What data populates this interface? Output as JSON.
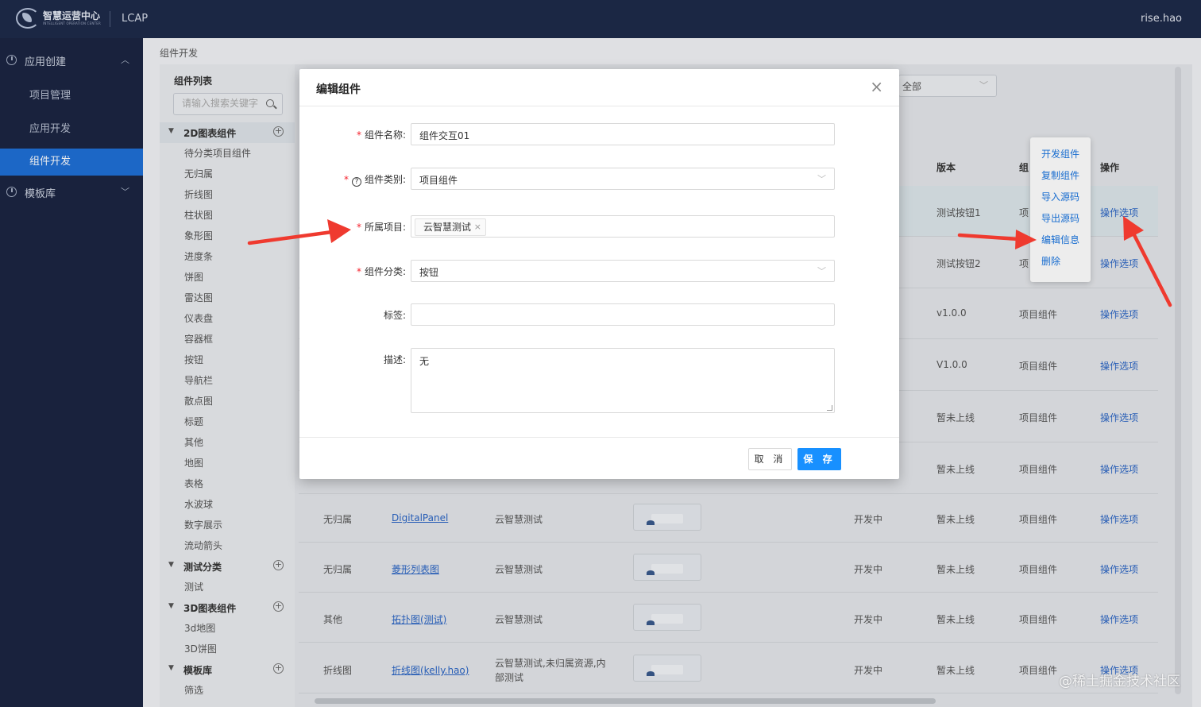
{
  "header": {
    "logo_title": "智慧运营中心",
    "logo_sub": "INTELLIGENT OPERATION CENTER",
    "app_name": "LCAP",
    "user": "rise.hao"
  },
  "sidebar": {
    "group_app": "应用创建",
    "items": [
      "项目管理",
      "应用开发",
      "组件开发"
    ],
    "group_templates": "模板库"
  },
  "breadcrumb": "组件开发",
  "tree": {
    "title": "组件列表",
    "search_placeholder": "请输入搜索关键字",
    "cat_2d": "2D图表组件",
    "leaves_2d": [
      "待分类项目组件",
      "无归属",
      "折线图",
      "柱状图",
      "象形图",
      "进度条",
      "饼图",
      "雷达图",
      "仪表盘",
      "容器框",
      "按钮",
      "导航栏",
      "散点图",
      "标题",
      "其他",
      "地图",
      "表格",
      "水波球",
      "数字展示",
      "流动箭头"
    ],
    "cat_test": "测试分类",
    "leaves_test": [
      "测试"
    ],
    "cat_3d": "3D图表组件",
    "leaves_3d": [
      "3d地图",
      "3D饼图"
    ],
    "cat_tpl": "模板库",
    "leaves_tpl": [
      "筛选"
    ]
  },
  "filter": {
    "value": "全部"
  },
  "table": {
    "headers": {
      "version": "版本",
      "group": "组",
      "action": "操作"
    },
    "rows_partial": [
      {
        "version": "测试按钮1",
        "group": "项",
        "action": "操作选项"
      },
      {
        "version": "测试按钮2",
        "group": "项",
        "action": "操作选项"
      },
      {
        "version": "v1.0.0",
        "group": "项目组件",
        "action": "操作选项"
      },
      {
        "version": "V1.0.0",
        "group": "项目组件",
        "action": "操作选项"
      },
      {
        "version": "暂未上线",
        "group": "项目组件",
        "action": "操作选项"
      },
      {
        "version": "暂未上线",
        "group": "项目组件",
        "action": "操作选项"
      }
    ],
    "rows_full": [
      {
        "cat": "无归属",
        "name": "DigitalPanel",
        "project": "云智慧测试",
        "status": "开发中",
        "version": "暂未上线",
        "group": "项目组件",
        "action": "操作选项"
      },
      {
        "cat": "无归属",
        "name": "菱形列表图",
        "project": "云智慧测试",
        "status": "开发中",
        "version": "暂未上线",
        "group": "项目组件",
        "action": "操作选项"
      },
      {
        "cat": "其他",
        "name": "拓扑图(测试)",
        "project": "云智慧测试",
        "status": "开发中",
        "version": "暂未上线",
        "group": "项目组件",
        "action": "操作选项"
      },
      {
        "cat": "折线图",
        "name": "折线图(kelly.hao)",
        "project": "云智慧测试,未归属资源,内部测试",
        "status": "开发中",
        "version": "暂未上线",
        "group": "项目组件",
        "action": "操作选项"
      }
    ]
  },
  "popmenu": [
    "开发组件",
    "复制组件",
    "导入源码",
    "导出源码",
    "编辑信息",
    "删除"
  ],
  "modal": {
    "title": "编辑组件",
    "fields": {
      "name_label": "组件名称:",
      "name_value": "组件交互01",
      "type_label": "组件类别:",
      "type_value": "项目组件",
      "project_label": "所属项目:",
      "project_tag": "云智慧测试",
      "class_label": "组件分类:",
      "class_value": "按钮",
      "tags_label": "标签:",
      "tags_value": "",
      "desc_label": "描述:",
      "desc_value": "无"
    },
    "cancel": "取 消",
    "save": "保 存"
  },
  "watermark": "@稀土掘金技术社区",
  "colors": {
    "topbar": "#1e2a4a",
    "sidebar": "#1b2542",
    "active": "#1f6fd6",
    "primary": "#1890ff",
    "arrow": "#ef3a2f"
  }
}
